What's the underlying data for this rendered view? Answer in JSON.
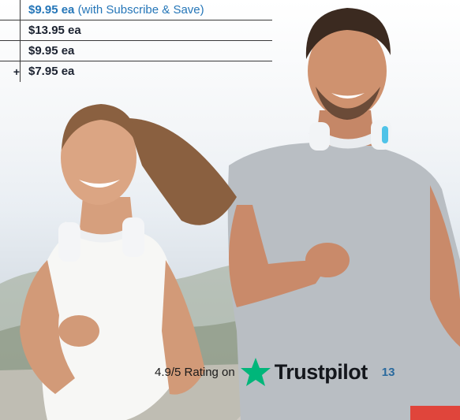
{
  "price_table": {
    "rows": [
      {
        "qty": "",
        "price": "$9.95 ea",
        "note": "(with Subscribe & Save)",
        "highlight": true
      },
      {
        "qty": "",
        "price": "$13.95 ea",
        "note": "",
        "highlight": false
      },
      {
        "qty": "",
        "price": "$9.95 ea",
        "note": "",
        "highlight": false
      },
      {
        "qty": "+",
        "price": "$7.95 ea",
        "note": "",
        "highlight": false
      }
    ]
  },
  "footer": {
    "rating_text": "4.9/5 Rating on",
    "brand": "Trustpilot",
    "page_number": "13",
    "star_color": "#00b67a"
  },
  "photo": {
    "description_icon": "runners-photo"
  }
}
